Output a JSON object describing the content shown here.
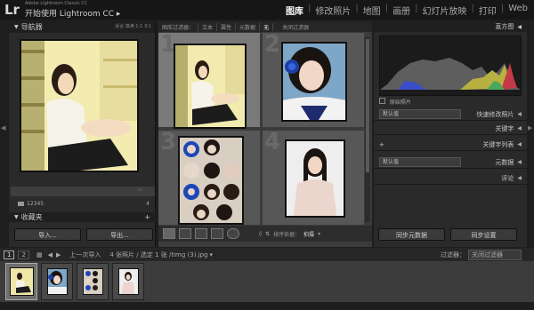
{
  "app": {
    "logo": "Lr",
    "subtitle": "Adobe Lightroom Classic CC",
    "title": "开始使用 Lightroom CC",
    "title_arrow": "▸"
  },
  "modules": [
    "图库",
    "修改照片",
    "地图",
    "画册",
    "幻灯片放映",
    "打印",
    "Web"
  ],
  "active_module": "图库",
  "navigator": {
    "label": "导航器",
    "options": "适合  填满  1:1  3:1"
  },
  "catalog": {
    "highlight_row": "",
    "folder_name": "12345",
    "folder_count": "4",
    "collections_label": "收藏夹"
  },
  "left_buttons": {
    "import": "导入...",
    "export": "导出..."
  },
  "filter_bar": {
    "label": "图库过滤器：",
    "items": [
      "文本",
      "属性",
      "元数据",
      "无"
    ],
    "preset": "关闭过滤器"
  },
  "grid": {
    "cells": [
      {
        "num": "1"
      },
      {
        "num": "2"
      },
      {
        "num": "3"
      },
      {
        "num": "4"
      }
    ]
  },
  "toolbar": {
    "sort_label": "排序依据：",
    "sort_value": "拍摄"
  },
  "right_panel": {
    "histogram_label": "直方图",
    "original_photo": "原始照片",
    "quick_develop_select": "默认值",
    "quick_develop": "快速修改照片",
    "keywording": "关键字",
    "keyword_list": "关键字列表",
    "metadata_select": "默认值",
    "metadata": "元数据",
    "comments": "评论",
    "sync_metadata": "同步元数据",
    "sync_settings": "同步设置"
  },
  "bottom_bar": {
    "page1": "1",
    "page2": "2",
    "source": "上一次导入",
    "count": "4 张照片 / 选定 1 张 / ",
    "filename": "timg (3).jpg",
    "filter_label": "过滤器：",
    "filter_value": "关闭过滤器"
  },
  "colors": {
    "background": "#1e1e1e",
    "panel": "#2a2a2a",
    "active_module": "#ffffff",
    "grid_bg": "#3b3b3b"
  }
}
